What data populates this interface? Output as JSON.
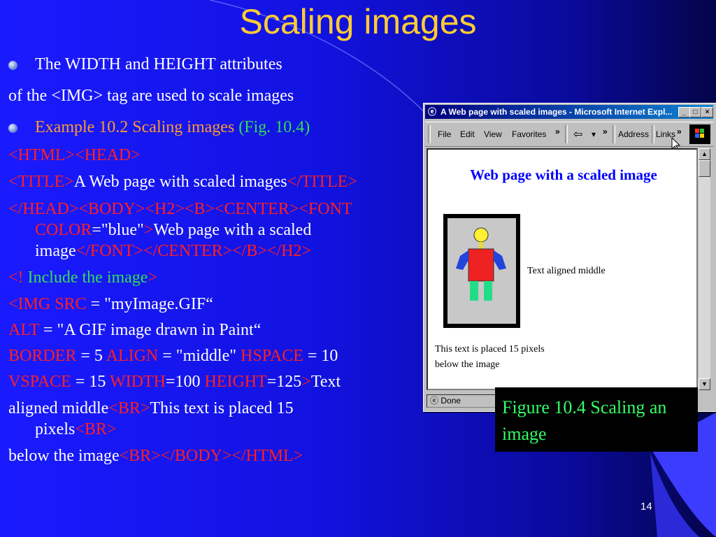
{
  "slide": {
    "title": "Scaling images",
    "number": "14",
    "bullet1": "The WIDTH and HEIGHT attributes",
    "line2": "of the <IMG> tag are used to scale images",
    "bullet2_text": "Example 10.2 Scaling images ",
    "bullet2_fig": "(Fig. 10.4)",
    "code": {
      "l1": "<HTML><HEAD>",
      "l2a": "<TITLE>",
      "l2b": "A Web page with scaled images",
      "l2c": "</TITLE>",
      "l3": "</HEAD><BODY><H2><B><CENTER><FONT",
      "l4a": "COLOR",
      "l4b": "=\"blue\"",
      "l4c": ">",
      "l4d": "Web page with a scaled",
      "l5a": "image",
      "l5b": "</FONT></CENTER></B></H2>",
      "l6a": "<!",
      "l6b": " Include the image",
      "l6c": ">",
      "l7a": "<IMG SRC",
      "l7b": " = \"myImage.GIF“",
      "l8a": "ALT",
      "l8b": " = \"A GIF image drawn in Paint“",
      "l9a": "BORDER",
      "l9b": " = 5 ",
      "l9c": "ALIGN",
      "l9d": " = \"middle\" ",
      "l9e": "HSPACE",
      "l9f": " = 10",
      "l10a": "VSPACE",
      "l10b": " = 15  ",
      "l10c": "WIDTH",
      "l10d": "=100 ",
      "l10e": "HEIGHT",
      "l10f": "=125",
      "l10g": ">",
      "l10h": "Text",
      "l11a": "aligned middle",
      "l11b": "<BR>",
      "l11c": "This text is placed 15",
      "l12a": "pixels",
      "l12b": "<BR>",
      "l13a": "below the image",
      "l13b": "<BR></BODY></HTML>"
    }
  },
  "browser": {
    "window_title": "A Web page with scaled images - Microsoft Internet Expl...",
    "menu": [
      "File",
      "Edit",
      "View",
      "Favorites"
    ],
    "more": "»",
    "back_icon": "⇦",
    "drop": "▾",
    "address_label": "Address",
    "links_label": "Links",
    "heading": "Web page with a scaled image",
    "caption_middle": "Text aligned middle",
    "caption_below_1": "This text is placed 15 pixels",
    "caption_below_2": "below the image",
    "status": "Done",
    "min_icon": "_",
    "max_icon": "□",
    "close_icon": "×",
    "scroll_up": "▲",
    "scroll_down": "▼"
  },
  "figure_caption": "Figure 10.4 Scaling an image",
  "colors": {
    "title": "#ffcc33",
    "code_tag": "#ff2020",
    "comment": "#33dd55",
    "example": "#ff9a2e",
    "caption_text": "#33ff66"
  }
}
